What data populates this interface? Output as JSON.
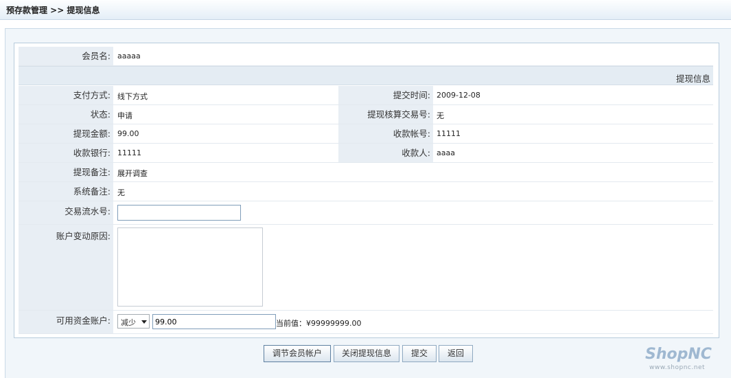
{
  "header": {
    "breadcrumb": "预存款管理 >> 提现信息"
  },
  "member": {
    "label": "会员名:",
    "value": "aaaaa"
  },
  "section_title": "提现信息",
  "fields": {
    "pay_method": {
      "label": "支付方式:",
      "value": "线下方式"
    },
    "submit_time": {
      "label": "提交时间:",
      "value": "2009-12-08"
    },
    "status": {
      "label": "状态:",
      "value": "申请"
    },
    "settle_no": {
      "label": "提现核算交易号:",
      "value": "无"
    },
    "amount": {
      "label": "提现金额:",
      "value": "99.00"
    },
    "account_no": {
      "label": "收款帐号:",
      "value": "11111"
    },
    "bank": {
      "label": "收款银行:",
      "value": "11111"
    },
    "payee": {
      "label": "收款人:",
      "value": "aaaa"
    },
    "remark": {
      "label": "提现备注:",
      "value": "展开调查"
    },
    "sys_remark": {
      "label": "系统备注:",
      "value": "无"
    }
  },
  "form": {
    "serial_label": "交易流水号:",
    "serial_value": "",
    "reason_label": "账户变动原因:",
    "reason_value": "",
    "fund_label": "可用资金账户:",
    "fund_mode": "减少",
    "fund_amount": "99.00",
    "current_value": "当前值：¥99999999.00"
  },
  "buttons": {
    "adjust": "调节会员帐户",
    "close": "关闭提现信息",
    "submit": "提交",
    "back": "返回"
  },
  "logo": {
    "brand": "ShopNC",
    "url": "www.shopnc.net"
  }
}
